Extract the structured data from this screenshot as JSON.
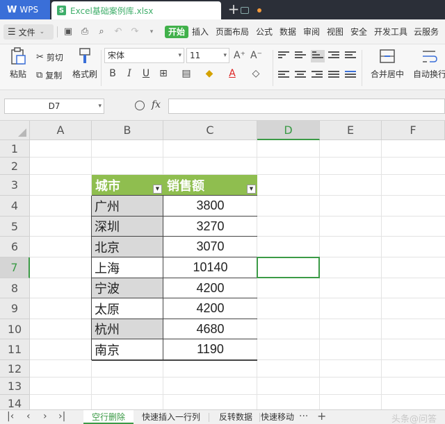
{
  "app": {
    "brand": "WPS",
    "doc_title": "Excel基础案例库.xlsx",
    "doc_icon_letter": "S"
  },
  "menu": {
    "file": "文件",
    "items": [
      "开始",
      "插入",
      "页面布局",
      "公式",
      "数据",
      "审阅",
      "视图",
      "安全",
      "开发工具",
      "云服务"
    ],
    "active": "开始"
  },
  "toolbar": {
    "paste": "粘贴",
    "cut": "剪切",
    "copy": "复制",
    "format_painter": "格式刷",
    "font_name": "宋体",
    "font_size": "11",
    "bold": "B",
    "italic": "I",
    "underline": "U",
    "merge_center": "合并居中",
    "auto_wrap": "自动换行"
  },
  "formula_bar": {
    "name_box": "D7",
    "fx": "fx",
    "value": ""
  },
  "grid": {
    "columns": [
      "A",
      "B",
      "C",
      "D",
      "E",
      "F"
    ],
    "rows": [
      "1",
      "2",
      "3",
      "4",
      "5",
      "6",
      "7",
      "8",
      "9",
      "10",
      "11",
      "12",
      "13",
      "14"
    ],
    "selected_column": "D",
    "selected_row": "7"
  },
  "table": {
    "headers": [
      "城市",
      "销售额"
    ],
    "rows": [
      {
        "city": "广州",
        "sales": "3800",
        "shaded": true
      },
      {
        "city": "深圳",
        "sales": "3270",
        "shaded": true
      },
      {
        "city": "北京",
        "sales": "3070",
        "shaded": true
      },
      {
        "city": "上海",
        "sales": "10140",
        "shaded": false
      },
      {
        "city": "宁波",
        "sales": "4200",
        "shaded": true
      },
      {
        "city": "太原",
        "sales": "4200",
        "shaded": false
      },
      {
        "city": "杭州",
        "sales": "4680",
        "shaded": true
      },
      {
        "city": "南京",
        "sales": "1190",
        "shaded": false
      }
    ],
    "header_color": "#8fbe4f",
    "shade_color": "#d9d9d9"
  },
  "sheets": {
    "tabs": [
      "空行删除",
      "快速插入一行列",
      "反转数据",
      "快速移动"
    ],
    "active": "空行删除",
    "more": "···",
    "add": "+"
  },
  "watermark": "头条@问答",
  "colors": {
    "accent": "#41b14b",
    "wps_blue": "#3a6fd8",
    "titlebar": "#2b2f38"
  }
}
